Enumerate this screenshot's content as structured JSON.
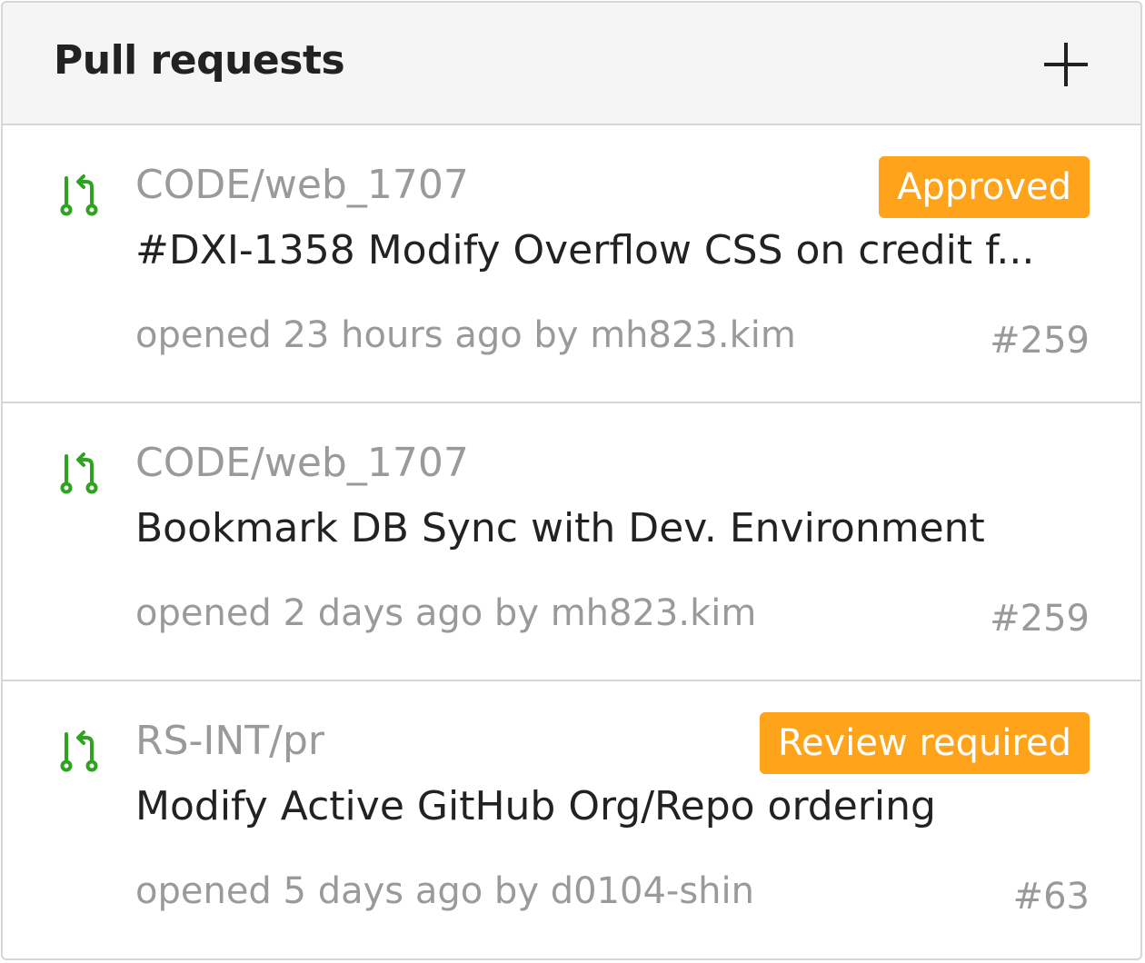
{
  "header": {
    "title": "Pull requests",
    "add_icon": "plus-icon"
  },
  "colors": {
    "icon_green": "#2ea31f",
    "badge_orange": "#ffa31a",
    "muted_text": "#9a9a9a",
    "primary_text": "#222222"
  },
  "pull_requests": [
    {
      "repo": "CODE/web_1707",
      "badge": "Approved",
      "title": "#DXI-1358 Modify Overflow CSS on credit f...",
      "meta": "opened 23 hours ago by mh823.kim",
      "number": "#259",
      "icon": "pull-request-icon"
    },
    {
      "repo": "CODE/web_1707",
      "badge": "",
      "title": "Bookmark DB Sync with Dev. Environment",
      "meta": "opened 2 days ago by mh823.kim",
      "number": "#259",
      "icon": "pull-request-icon"
    },
    {
      "repo": "RS-INT/pr",
      "badge": "Review required",
      "title": "Modify Active GitHub Org/Repo ordering",
      "meta": "opened 5 days ago by d0104-shin",
      "number": "#63",
      "icon": "pull-request-icon"
    }
  ]
}
